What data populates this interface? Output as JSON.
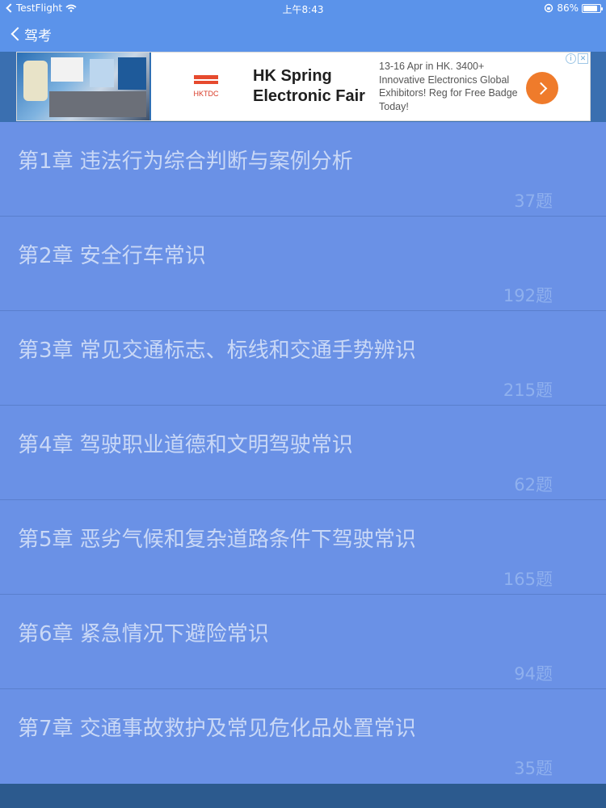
{
  "status_bar": {
    "back_app": "TestFlight",
    "time": "上午8:43",
    "battery": "86%",
    "battery_level": 0.86
  },
  "nav": {
    "back_label": "驾考"
  },
  "ad": {
    "logo_text": "HKTDC",
    "headline": "HK Spring Electronic Fair",
    "body": "13-16 Apr in HK. 3400+ Innovative Electronics Global Exhibitors! Reg for Free Badge Today!",
    "info_glyph": "i",
    "close_glyph": "✕"
  },
  "chapters": [
    {
      "title": "第1章 违法行为综合判断与案例分析",
      "count": "37题"
    },
    {
      "title": "第2章 安全行车常识",
      "count": "192题"
    },
    {
      "title": "第3章 常见交通标志、标线和交通手势辨识",
      "count": "215题"
    },
    {
      "title": "第4章 驾驶职业道德和文明驾驶常识",
      "count": "62题"
    },
    {
      "title": "第5章 恶劣气候和复杂道路条件下驾驶常识",
      "count": "165题"
    },
    {
      "title": "第6章 紧急情况下避险常识",
      "count": "94题"
    },
    {
      "title": "第7章 交通事故救护及常见危化品处置常识",
      "count": "35题"
    }
  ]
}
